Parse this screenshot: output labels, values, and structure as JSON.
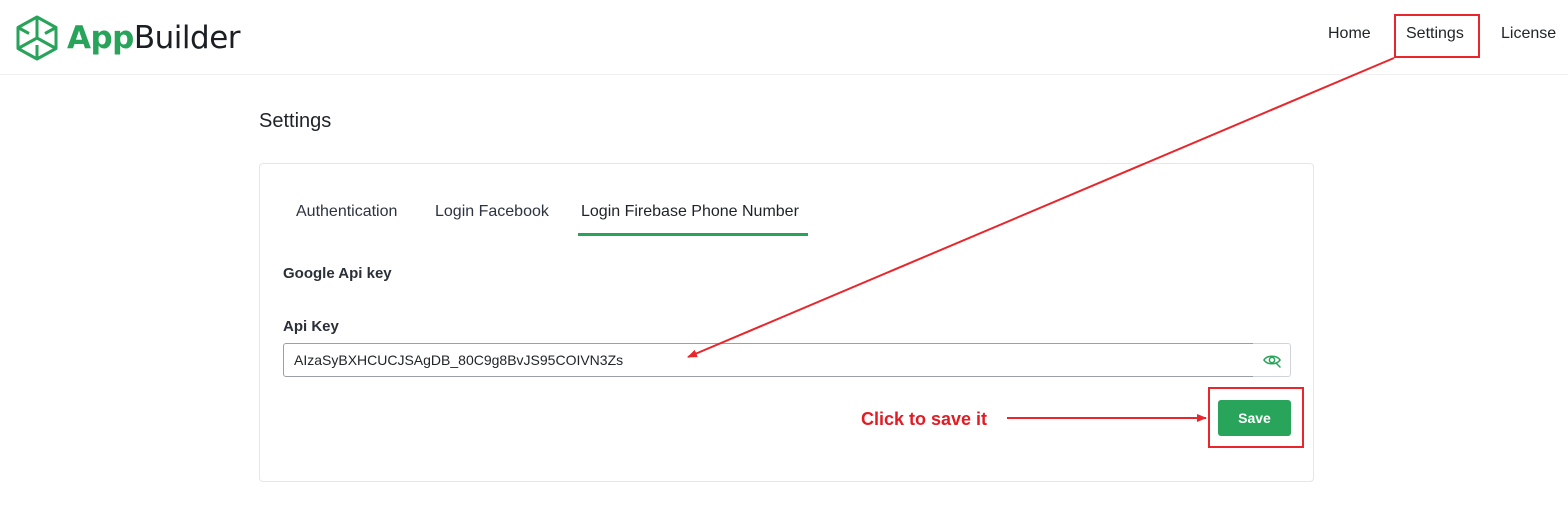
{
  "header": {
    "brand": {
      "part1": "App",
      "part2": "Builder"
    },
    "nav": [
      "Home",
      "Settings",
      "License"
    ]
  },
  "page": {
    "title": "Settings"
  },
  "tabs": [
    {
      "label": "Authentication",
      "active": false
    },
    {
      "label": "Login Facebook",
      "active": false
    },
    {
      "label": "Login Firebase Phone Number",
      "active": true
    }
  ],
  "form": {
    "section_title": "Google Api key",
    "api_key_label": "Api Key",
    "api_key_value": "AIzaSyBXHCUCJSAgDB_80C9g8BvJS95COIVN3Zs",
    "toggle_icon": "eye-off-icon",
    "save_label": "Save"
  },
  "annotation": {
    "text": "Click to save it",
    "color": "#e31b23"
  },
  "colors": {
    "accent": "#28a55b",
    "annotation": "#e8262b"
  }
}
